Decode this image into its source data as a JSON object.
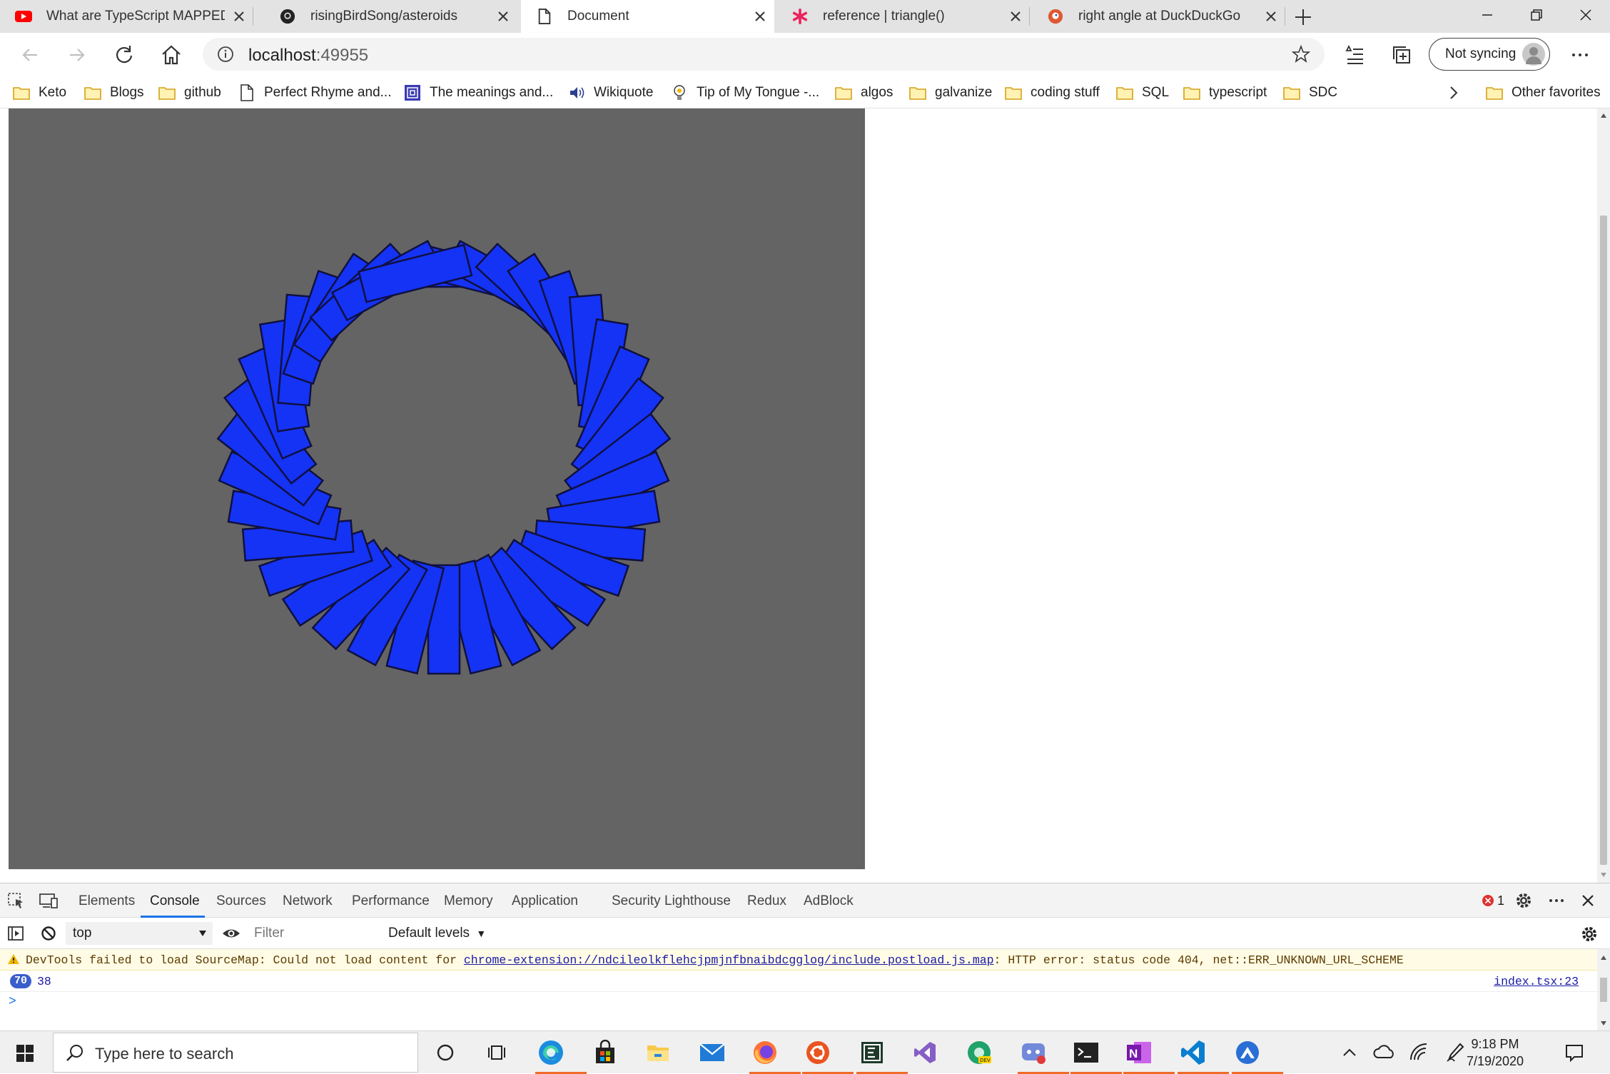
{
  "browser": {
    "tabs": [
      {
        "title": "What are TypeScript MAPPED Ty",
        "favicon": "youtube-icon"
      },
      {
        "title": "risingBirdSong/asteroids",
        "favicon": "github-icon"
      },
      {
        "title": "Document",
        "favicon": "page-icon",
        "active": true
      },
      {
        "title": "reference | triangle()",
        "favicon": "p5-asterisk-icon"
      },
      {
        "title": "right angle at DuckDuckGo",
        "favicon": "duckduckgo-icon"
      }
    ],
    "address": {
      "host": "localhost",
      "port": ":49955"
    },
    "sync_label": "Not syncing",
    "favorites": [
      {
        "label": "Keto",
        "icon": "folder-icon"
      },
      {
        "label": "Blogs",
        "icon": "folder-icon"
      },
      {
        "label": "github",
        "icon": "folder-icon"
      },
      {
        "label": "Perfect Rhyme and...",
        "icon": "page-icon"
      },
      {
        "label": "The meanings and...",
        "icon": "spiral-icon"
      },
      {
        "label": "Wikiquote",
        "icon": "speaker-icon"
      },
      {
        "label": "Tip of My Tongue -...",
        "icon": "bulb-icon"
      },
      {
        "label": "algos",
        "icon": "folder-icon"
      },
      {
        "label": "galvanize",
        "icon": "folder-icon"
      },
      {
        "label": "coding stuff",
        "icon": "folder-icon"
      },
      {
        "label": "SQL",
        "icon": "folder-icon"
      },
      {
        "label": "typescript",
        "icon": "folder-icon"
      },
      {
        "label": "SDC",
        "icon": "folder-icon"
      }
    ],
    "other_favorites": "Other favorites"
  },
  "canvas": {
    "background": "#646464",
    "rect_fill": "#1433f5",
    "rect_stroke": "#101040",
    "rect_count": 38
  },
  "devtools": {
    "tabs": [
      "Elements",
      "Console",
      "Sources",
      "Network",
      "Performance",
      "Memory",
      "Application",
      "Security",
      "Lighthouse",
      "Redux",
      "AdBlock"
    ],
    "active_tab": "Console",
    "error_count": "1",
    "context": "top",
    "filter_placeholder": "Filter",
    "levels": "Default levels",
    "warning": {
      "prefix": "DevTools failed to load SourceMap: Could not load content for ",
      "link": "chrome-extension://ndcileolkflehcjpmjnfbnaibdcgglog/include.postload.js.map",
      "suffix": ": HTTP error: status code 404, net::ERR_UNKNOWN_URL_SCHEME"
    },
    "log": {
      "count": "70",
      "value": "38",
      "source": "index.tsx:23"
    },
    "prompt": ">"
  },
  "taskbar": {
    "search_placeholder": "Type here to search",
    "time": "9:18 PM",
    "date": "7/19/2020",
    "accent": "#f06a2a"
  }
}
